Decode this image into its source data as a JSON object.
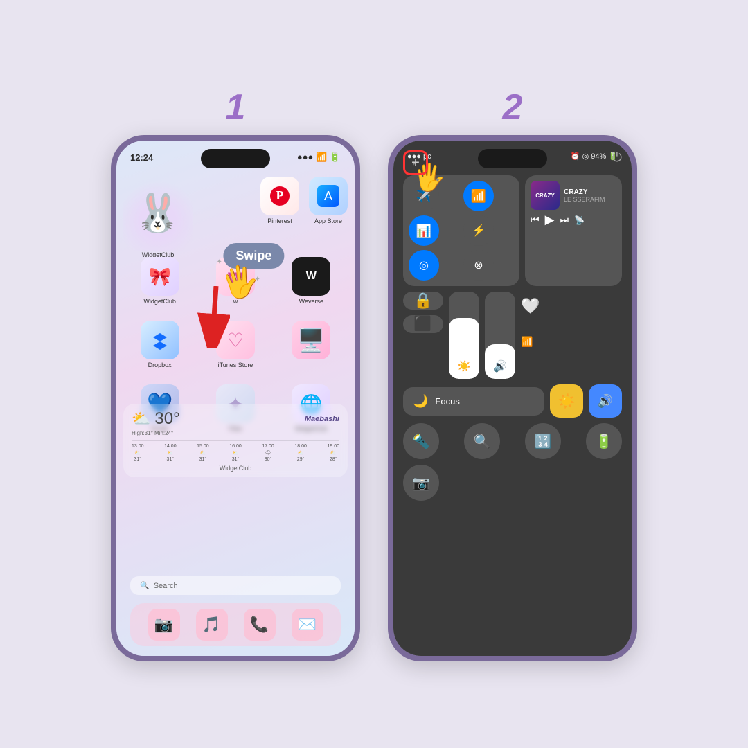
{
  "background_color": "#e8e4f0",
  "steps": [
    {
      "number": "1",
      "swipe_label": "Swipe",
      "phone": {
        "time": "12:24",
        "row1_apps": [
          {
            "label": "Pinterest",
            "icon": "🅟",
            "color": "pinterest"
          },
          {
            "label": "App Store",
            "icon": "🅐",
            "color": "appstore"
          }
        ],
        "row2_apps": [
          {
            "label": "WidgetClub",
            "icon": "🐰",
            "color": "widget"
          },
          {
            "label": "w",
            "icon": "𝐰",
            "color": "w"
          },
          {
            "label": "Weverse",
            "icon": "𝗪",
            "color": "weverse"
          }
        ],
        "row3_apps": [
          {
            "label": "Dropbox",
            "icon": "◆",
            "color": "dropbox"
          },
          {
            "label": "iTunes Store",
            "icon": "♡",
            "color": "itunes"
          },
          {
            "label": "💻",
            "icon": "💻",
            "color": "pink"
          }
        ],
        "row4_apps": [
          {
            "label": "Kindle",
            "icon": "❤",
            "color": "kindle"
          },
          {
            "label": "Files",
            "icon": "✦",
            "color": "files"
          },
          {
            "label": "WidgetClub",
            "icon": "🌐",
            "color": "widget2"
          }
        ],
        "weather": {
          "temp": "30°",
          "city": "Maebashi",
          "subtitle": "High:31° Min:24°",
          "hours": [
            "13:00",
            "14:00",
            "15:00",
            "16:00",
            "17:00",
            "18:00",
            "19:00"
          ],
          "temps": [
            "31°",
            "31°",
            "31°",
            "31°",
            "30°",
            "29°",
            "28°"
          ]
        },
        "search_placeholder": "🔍 Search",
        "dock_icons": [
          "📷",
          "🎵",
          "📞",
          "✉️"
        ],
        "widgetclub_label": "WidgetClub"
      }
    },
    {
      "number": "2",
      "phone": {
        "status_left": "●●● pc",
        "status_right": "⏰ ◎ 94% 🔋",
        "plus_button": "+",
        "power_icon": "⏻",
        "music": {
          "title": "CRAZY",
          "artist": "LE SSERAFIM",
          "art_text": "CRAZY"
        },
        "focus_label": "Focus",
        "sliders": {
          "brightness_pct": 70,
          "volume_pct": 40
        }
      }
    }
  ]
}
